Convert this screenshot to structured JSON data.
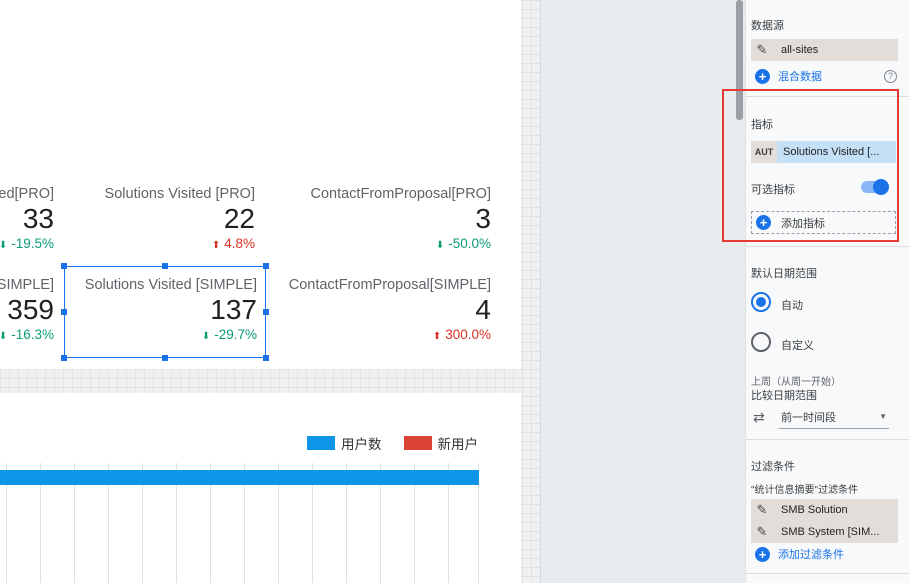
{
  "scorecards": [
    {
      "label": "ed[PRO]",
      "value": "33",
      "delta": "-19.5%",
      "trend": "down"
    },
    {
      "label": "Solutions Visited [PRO]",
      "value": "22",
      "delta": "4.8%",
      "trend": "up"
    },
    {
      "label": "ContactFromProposal[PRO]",
      "value": "3",
      "delta": "-50.0%",
      "trend": "down"
    },
    {
      "label": "[SIMPLE]",
      "value": "359",
      "delta": "-16.3%",
      "trend": "down"
    },
    {
      "label": "Solutions Visited [SIMPLE]",
      "value": "137",
      "delta": "-29.7%",
      "trend": "down"
    },
    {
      "label": "ContactFromProposal[SIMPLE]",
      "value": "4",
      "delta": "300.0%",
      "trend": "up"
    }
  ],
  "chart": {
    "legend": [
      {
        "name": "用户数",
        "color": "#0d96e8"
      },
      {
        "name": "新用户",
        "color": "#db4437"
      }
    ]
  },
  "chart_data": {
    "type": "bar",
    "series": [
      {
        "name": "用户数"
      },
      {
        "name": "新用户"
      }
    ]
  },
  "panel": {
    "datasource_title": "数据源",
    "datasource_name": "all-sites",
    "blend_data": "混合数据",
    "metric_title": "指标",
    "metric_type": "AUT",
    "metric_name": "Solutions Visited [...",
    "optional_metric": "可选指标",
    "add_metric": "添加指标",
    "date_range_title": "默认日期范围",
    "auto": "自动",
    "custom": "自定义",
    "compare_note": "上周（从周一开始）",
    "compare_title": "比较日期范围",
    "compare_value": "前一时间段",
    "filter_title": "过滤条件",
    "filter_sub": "\"统计信息摘要\"过滤条件",
    "filters": [
      "SMB Solution",
      "SMB System [SIM..."
    ],
    "add_filter": "添加过滤条件"
  }
}
